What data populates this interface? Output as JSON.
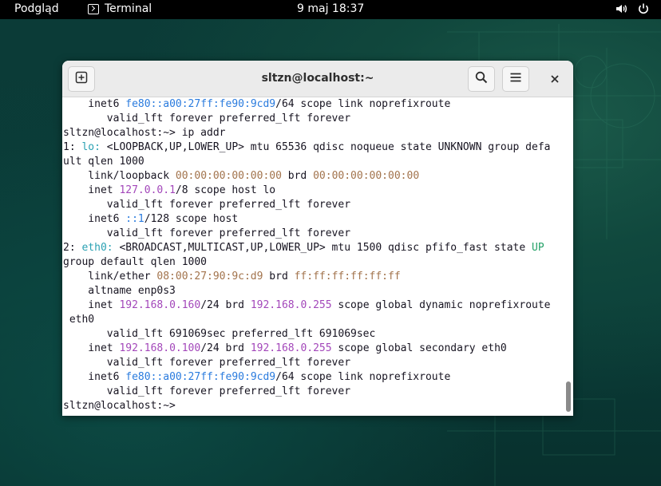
{
  "topbar": {
    "activities": "Podgląd",
    "app_name": "Terminal",
    "clock": "9 maj  18:37"
  },
  "window": {
    "title": "sltzn@localhost:~"
  },
  "terminal": {
    "lines": [
      [
        {
          "t": "    inet6 "
        },
        {
          "t": "fe80::a00:27ff:fe90:9cd9",
          "c": "blue"
        },
        {
          "t": "/64 scope link noprefixroute"
        }
      ],
      [
        {
          "t": "       valid_lft forever preferred_lft forever"
        }
      ],
      [
        {
          "t": "sltzn@localhost:~> ip addr"
        }
      ],
      [
        {
          "t": "1: "
        },
        {
          "t": "lo:",
          "c": "cyan"
        },
        {
          "t": " <LOOPBACK,UP,LOWER_UP> mtu 65536 qdisc noqueue state UNKNOWN group defa"
        }
      ],
      [
        {
          "t": "ult qlen 1000"
        }
      ],
      [
        {
          "t": "    link/loopback "
        },
        {
          "t": "00:00:00:00:00:00",
          "c": "brown"
        },
        {
          "t": " brd "
        },
        {
          "t": "00:00:00:00:00:00",
          "c": "brown"
        }
      ],
      [
        {
          "t": "    inet "
        },
        {
          "t": "127.0.0.1",
          "c": "mag"
        },
        {
          "t": "/8 scope host lo"
        }
      ],
      [
        {
          "t": "       valid_lft forever preferred_lft forever"
        }
      ],
      [
        {
          "t": "    inet6 "
        },
        {
          "t": "::1",
          "c": "blue"
        },
        {
          "t": "/128 scope host"
        }
      ],
      [
        {
          "t": "       valid_lft forever preferred_lft forever"
        }
      ],
      [
        {
          "t": "2: "
        },
        {
          "t": "eth0:",
          "c": "cyan"
        },
        {
          "t": " <BROADCAST,MULTICAST,UP,LOWER_UP> mtu 1500 qdisc pfifo_fast state "
        },
        {
          "t": "UP",
          "c": "green"
        }
      ],
      [
        {
          "t": "group default qlen 1000"
        }
      ],
      [
        {
          "t": "    link/ether "
        },
        {
          "t": "08:00:27:90:9c:d9",
          "c": "brown"
        },
        {
          "t": " brd "
        },
        {
          "t": "ff:ff:ff:ff:ff:ff",
          "c": "brown"
        }
      ],
      [
        {
          "t": "    altname enp0s3"
        }
      ],
      [
        {
          "t": "    inet "
        },
        {
          "t": "192.168.0.160",
          "c": "mag"
        },
        {
          "t": "/24 brd "
        },
        {
          "t": "192.168.0.255",
          "c": "mag"
        },
        {
          "t": " scope global dynamic noprefixroute"
        }
      ],
      [
        {
          "t": " eth0"
        }
      ],
      [
        {
          "t": "       valid_lft 691069sec preferred_lft 691069sec"
        }
      ],
      [
        {
          "t": "    inet "
        },
        {
          "t": "192.168.0.100",
          "c": "mag"
        },
        {
          "t": "/24 brd "
        },
        {
          "t": "192.168.0.255",
          "c": "mag"
        },
        {
          "t": " scope global secondary eth0"
        }
      ],
      [
        {
          "t": "       valid_lft forever preferred_lft forever"
        }
      ],
      [
        {
          "t": "    inet6 "
        },
        {
          "t": "fe80::a00:27ff:fe90:9cd9",
          "c": "blue"
        },
        {
          "t": "/64 scope link noprefixroute"
        }
      ],
      [
        {
          "t": "       valid_lft forever preferred_lft forever"
        }
      ],
      [
        {
          "t": "sltzn@localhost:~> "
        }
      ]
    ]
  },
  "colors": {
    "blue": "#2a7bde",
    "cyan": "#2aa1b3",
    "mag": "#a347ba",
    "brown": "#a2734c",
    "green": "#26a269"
  },
  "icons": {
    "new_tab": "new-tab-icon",
    "search": "search-icon",
    "menu": "hamburger-menu-icon",
    "close": "close-icon",
    "volume": "volume-icon",
    "power": "power-icon",
    "terminal": "terminal-icon"
  }
}
